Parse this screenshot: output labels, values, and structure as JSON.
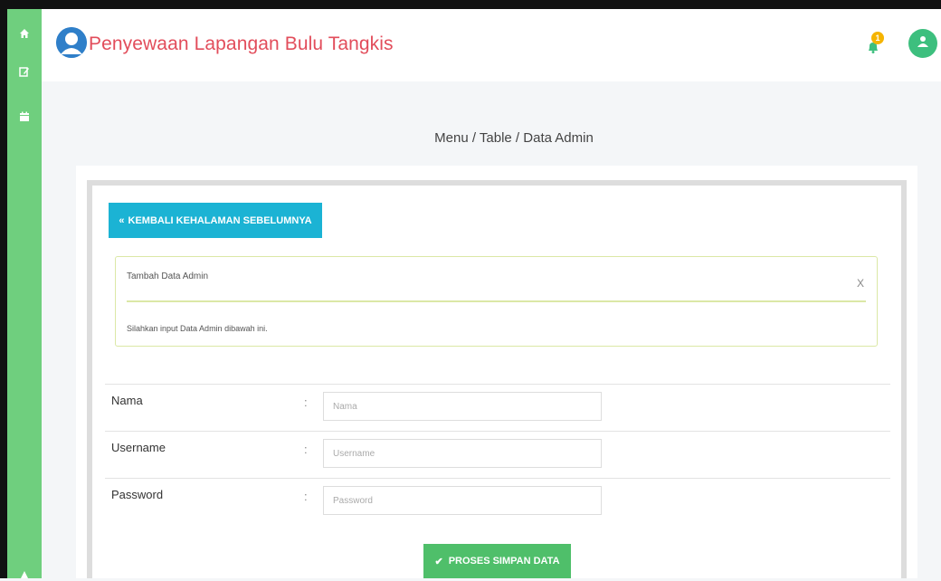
{
  "app": {
    "title": "Penyewaan Lapangan Bulu Tangkis"
  },
  "sidebar": {
    "icons": [
      {
        "name": "home-icon",
        "glyph": "🏠"
      },
      {
        "name": "edit-icon",
        "glyph": "✎"
      },
      {
        "name": "calendar-icon",
        "glyph": "▦"
      }
    ]
  },
  "header": {
    "notifications": {
      "count": "1"
    }
  },
  "breadcrumb": "Menu / Table / Data Admin",
  "back_button": {
    "icon": "«",
    "label": "KEMBALI KEHALAMAN SEBELUMNYA"
  },
  "alert": {
    "title": "Tambah Data Admin",
    "close": "X",
    "message": "Silahkan input Data Admin dibawah ini."
  },
  "form": {
    "separator": ":",
    "fields": [
      {
        "label": "Nama",
        "placeholder": "Nama",
        "value": ""
      },
      {
        "label": "Username",
        "placeholder": "Username",
        "value": ""
      },
      {
        "label": "Password",
        "placeholder": "Password",
        "value": ""
      }
    ]
  },
  "submit_button": {
    "icon": "✔",
    "label": "PROSES SIMPAN DATA"
  },
  "colors": {
    "sidebar": "#6fcf7e",
    "title": "#e24d5b",
    "back_button": "#1bb3d4",
    "submit_button": "#4fbf6a",
    "badge": "#f5b400",
    "user": "#3dbf7e"
  }
}
